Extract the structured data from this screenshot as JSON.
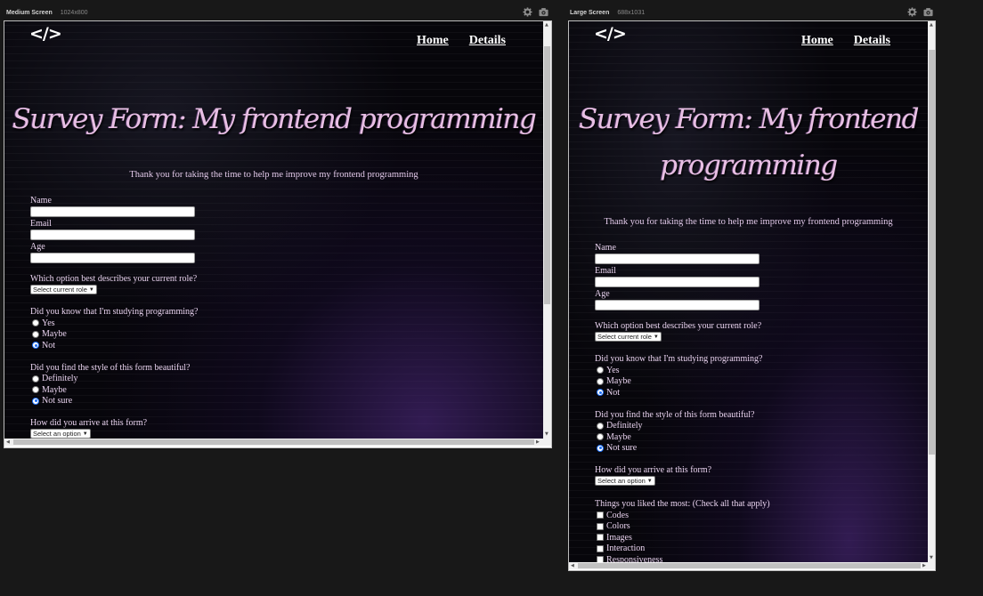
{
  "panels": [
    {
      "name": "Medium Screen",
      "size": "1024x800"
    },
    {
      "name": "Large Screen",
      "size": "688x1031"
    }
  ],
  "icons": {
    "settings": "gear-icon",
    "screenshot": "camera-icon",
    "logo": "code-icon"
  },
  "logo_text": "</>",
  "nav": {
    "home": "Home",
    "details": "Details"
  },
  "page": {
    "title": "Survey Form: My frontend programming",
    "title_line1": "Survey Form: My frontend",
    "title_line2": "programming",
    "description": "Thank you for taking the time to help me improve my frontend programming"
  },
  "form": {
    "name_label": "Name",
    "email_label": "Email",
    "age_label": "Age",
    "role_question": "Which option best describes your current role?",
    "role_selected": "Select current role",
    "studying_question": "Did you know that I'm studying programming?",
    "studying_options": [
      "Yes",
      "Maybe",
      "Not"
    ],
    "studying_selected": "Not",
    "style_question": "Did you find the style of this form beautiful?",
    "style_options": [
      "Definitely",
      "Maybe",
      "Not sure"
    ],
    "style_selected": "Not sure",
    "arrive_question": "How did you arrive at this form?",
    "arrive_selected": "Select an option",
    "liked_question": "Things you liked the most: (Check all that apply)",
    "liked_options": [
      "Codes",
      "Colors",
      "Images",
      "Interaction",
      "Responsiveness"
    ]
  },
  "colors": {
    "title": "#e8bfe4",
    "text": "#e8d2ee",
    "background": "#07060b",
    "chrome": "#181818",
    "radio_accent": "#1d6ef5"
  }
}
